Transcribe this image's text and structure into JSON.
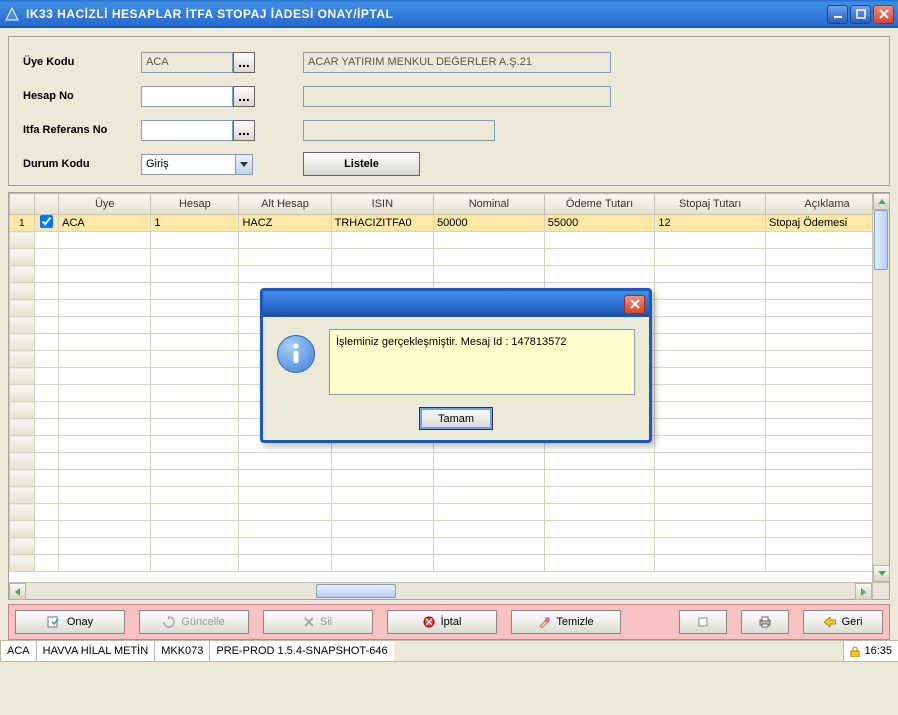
{
  "window": {
    "title": "IK33 HACİZLİ HESAPLAR İTFA STOPAJ İADESİ ONAY/İPTAL"
  },
  "form": {
    "uye_kodu_label": "Üye Kodu",
    "uye_kodu_value": "ACA",
    "uye_kodu_desc": "ACAR YATIRIM MENKUL DEĞERLER A.Ş.21",
    "hesap_no_label": "Hesap No",
    "hesap_no_value": "",
    "itfa_ref_label": "Itfa Referans No",
    "itfa_ref_value": "",
    "durum_kodu_label": "Durum Kodu",
    "durum_kodu_value": "Giriş",
    "listele_label": "Listele"
  },
  "grid": {
    "headers": [
      "Üye",
      "Hesap",
      "Alt Hesap",
      "ISIN",
      "Nominal",
      "Ödeme Tutarı",
      "Stopaj Tutarı",
      "Açıklama"
    ],
    "row_num": "1",
    "row": {
      "uye": "ACA",
      "hesap": "1",
      "alt_hesap": "HACZ",
      "isin": "TRHACIZITFA0",
      "nominal": "50000",
      "odeme": "55000",
      "stopaj": "12",
      "aciklama": "Stopaj Ödemesi"
    }
  },
  "toolbar": {
    "onay": "Onay",
    "guncelle": "Güncelle",
    "sil": "Sil",
    "iptal": "İptal",
    "temizle": "Temizle",
    "geri": "Geri"
  },
  "status": {
    "c1": "ACA",
    "c2": "HAVVA HİLAL METİN",
    "c3": "MKK073",
    "c4": "PRE-PROD 1.5.4-SNAPSHOT-646",
    "time": "16:35"
  },
  "dialog": {
    "message": "İşleminiz gerçekleşmiştir. Mesaj Id : 147813572",
    "ok_label": "Tamam"
  }
}
